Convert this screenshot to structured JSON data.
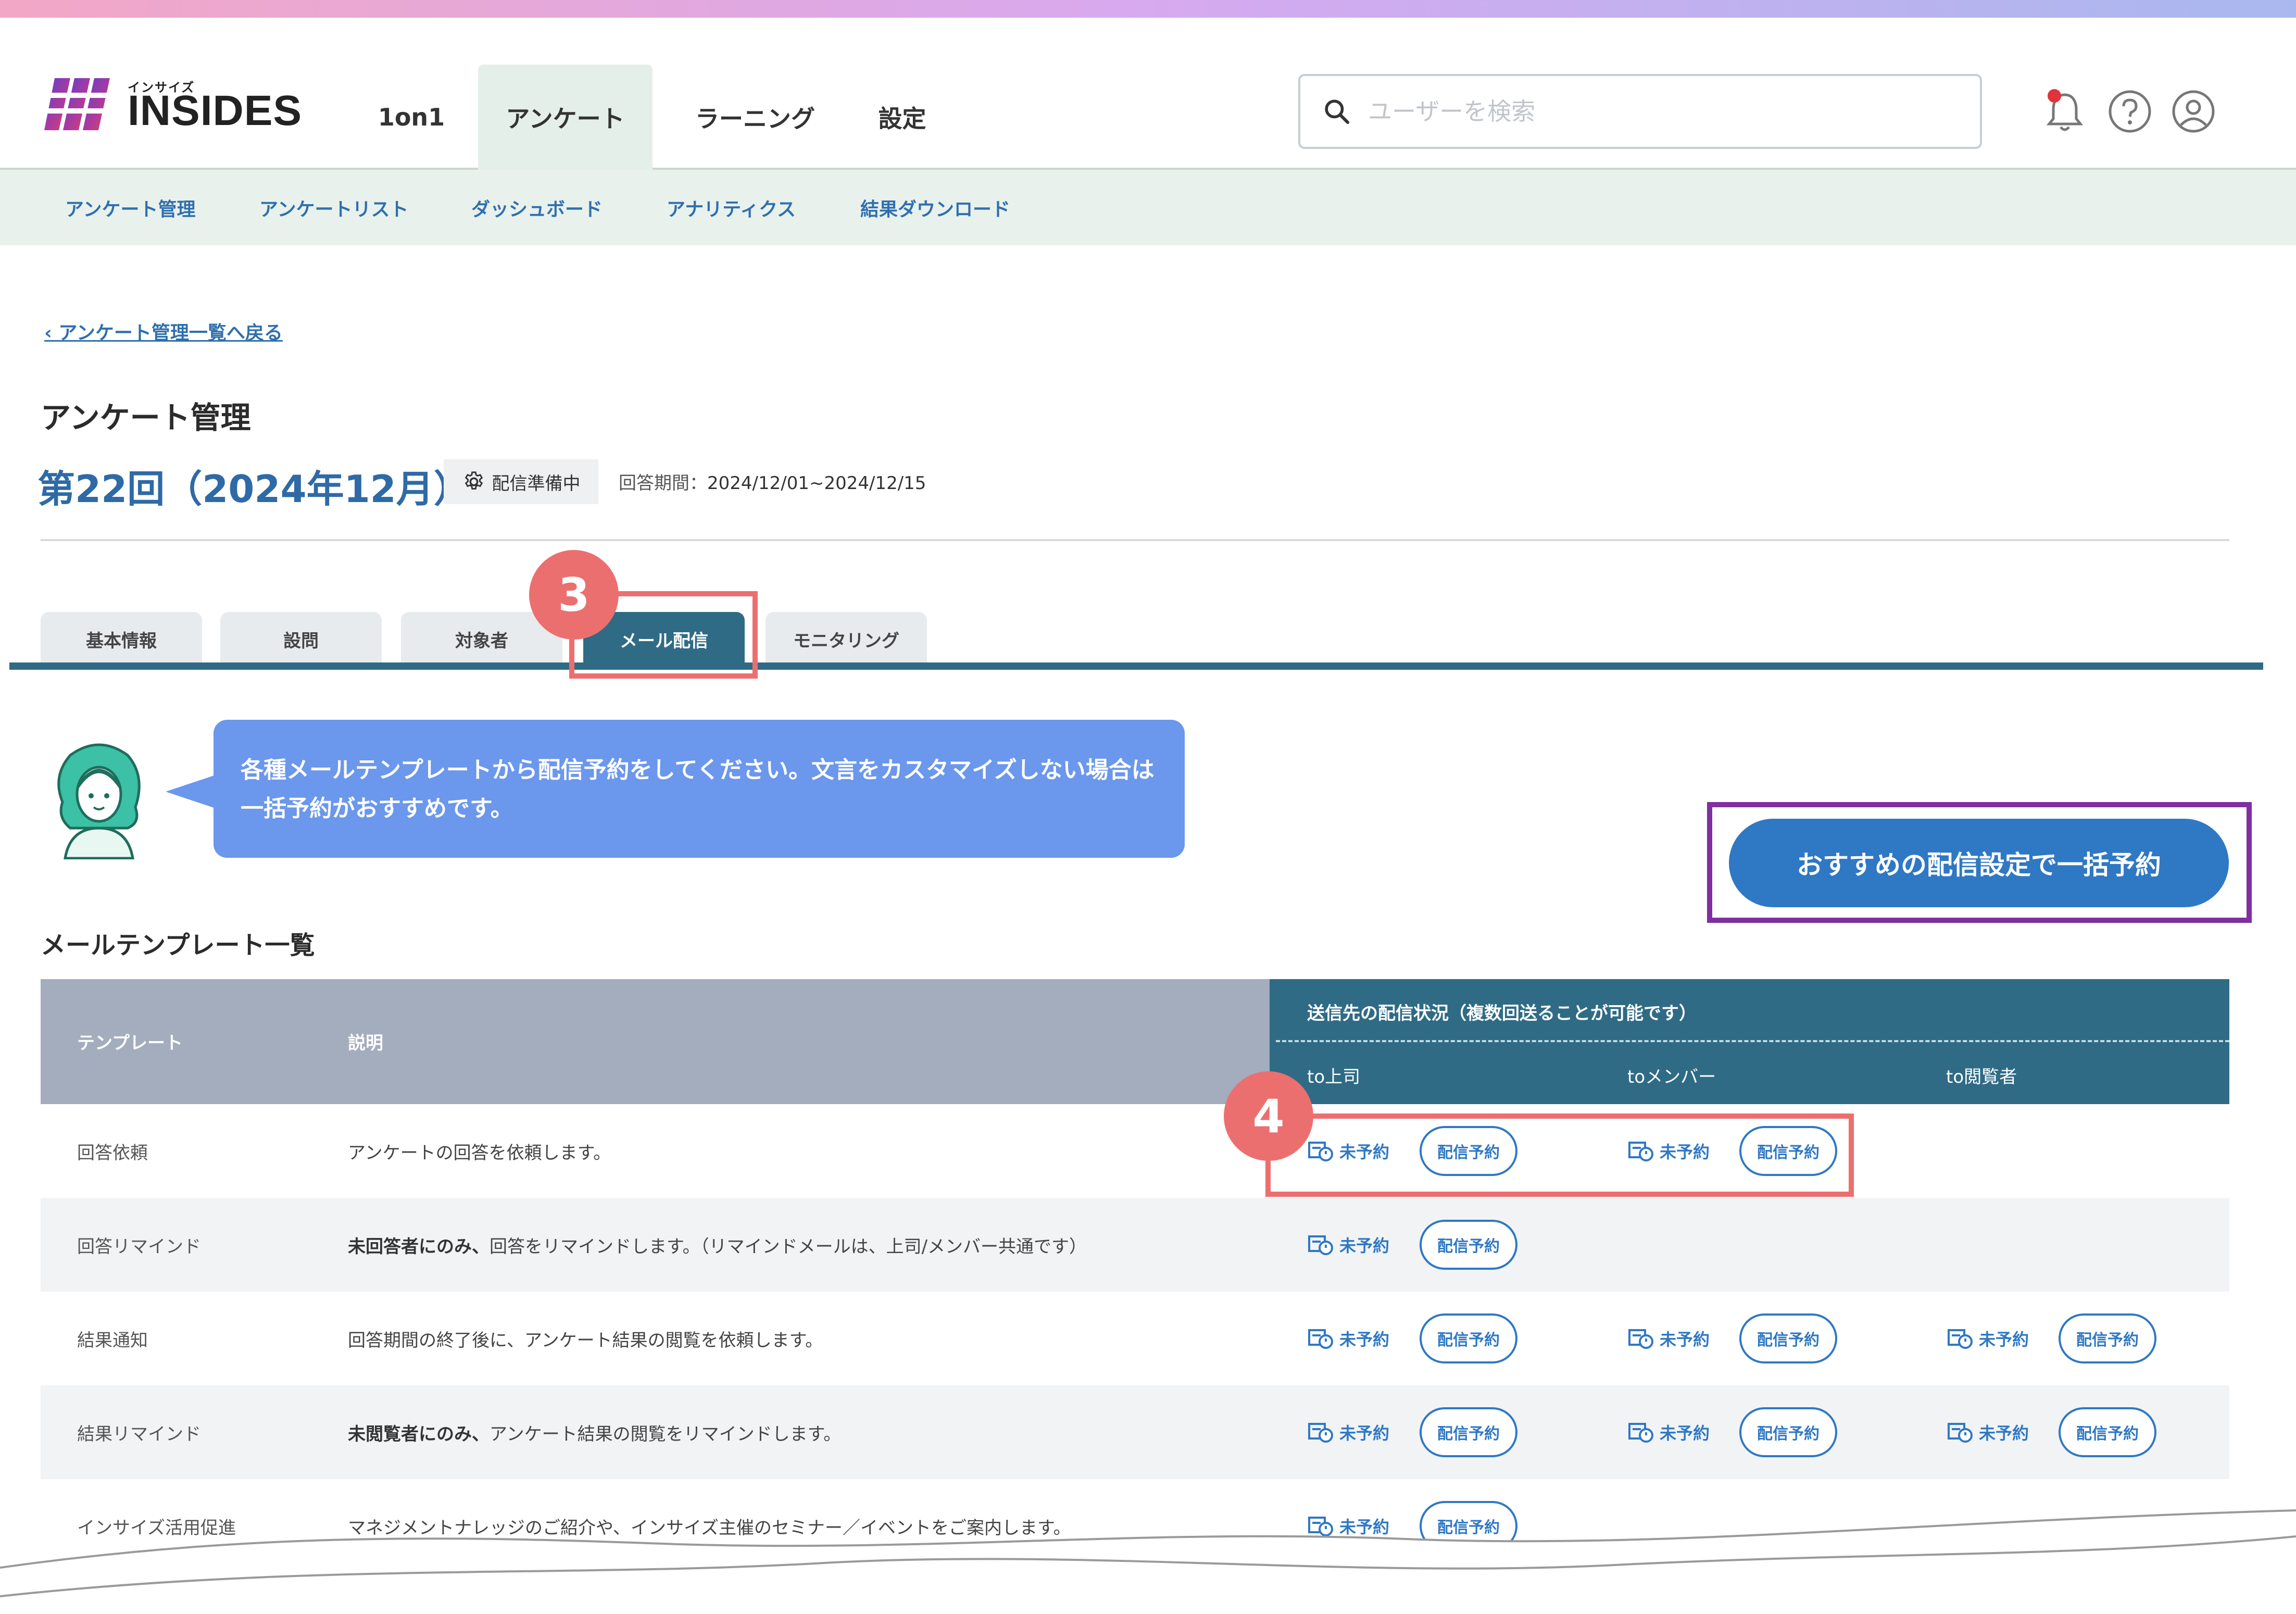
{
  "header": {
    "logo_small": "インサイズ",
    "logo_brand": "INSIDES",
    "nav": [
      "1on1",
      "アンケート",
      "ラーニング",
      "設定"
    ],
    "active_nav": "アンケート",
    "search_placeholder": "ユーザーを検索",
    "icons": [
      "bell-icon",
      "help-icon",
      "user-icon"
    ],
    "notification_color": "#e0333a"
  },
  "subnav": [
    "アンケート管理",
    "アンケートリスト",
    "ダッシュボード",
    "アナリティクス",
    "結果ダウンロード"
  ],
  "back_link": "アンケート管理一覧へ戻る",
  "page_title": "アンケート管理",
  "survey": {
    "title": "第22回（2024年12月）",
    "status": "配信準備中",
    "period_label": "回答期間：",
    "period": "2024/12/01~2024/12/15"
  },
  "tabs": [
    "基本情報",
    "設問",
    "対象者",
    "メール配信",
    "モニタリング"
  ],
  "active_tab": "メール配信",
  "annotations": {
    "step3": "3",
    "step4": "4"
  },
  "bubble_text": "各種メールテンプレートから配信予約をしてください。文言をカスタマイズしない場合は一括予約がおすすめです。",
  "cta_label": "おすすめの配信設定で一括予約",
  "section_title": "メールテンプレート一覧",
  "table": {
    "col_template": "テンプレート",
    "col_desc": "説明",
    "col_delivery": "送信先の配信状況（複数回送ることが可能です）",
    "targets": [
      "to上司",
      "toメンバー",
      "to閲覧者"
    ],
    "status_label": "未予約",
    "reserve_label": "配信予約",
    "rows": [
      {
        "name": "回答依頼",
        "desc_bold": "",
        "desc": "アンケートの回答を依頼します。"
      },
      {
        "name": "回答リマインド",
        "desc_bold": "未回答者にのみ、",
        "desc": "回答をリマインドします。（リマインドメールは、上司/メンバー共通です）"
      },
      {
        "name": "結果通知",
        "desc_bold": "",
        "desc": "回答期間の終了後に、アンケート結果の閲覧を依頼します。"
      },
      {
        "name": "結果リマインド",
        "desc_bold": "未閲覧者にのみ、",
        "desc": "アンケート結果の閲覧をリマインドします。"
      },
      {
        "name": "インサイズ活用促進",
        "desc_bold": "",
        "desc": "マネジメントナレッジのご紹介や、インサイズ主催のセミナー／イベントをご案内します。"
      }
    ]
  },
  "colors": {
    "accent": "#2f78c4",
    "tab_active": "#2f6b85",
    "annotation_red": "#ec6f6f",
    "annotation_purple": "#7f2fa0",
    "bubble": "#6b97ec"
  }
}
